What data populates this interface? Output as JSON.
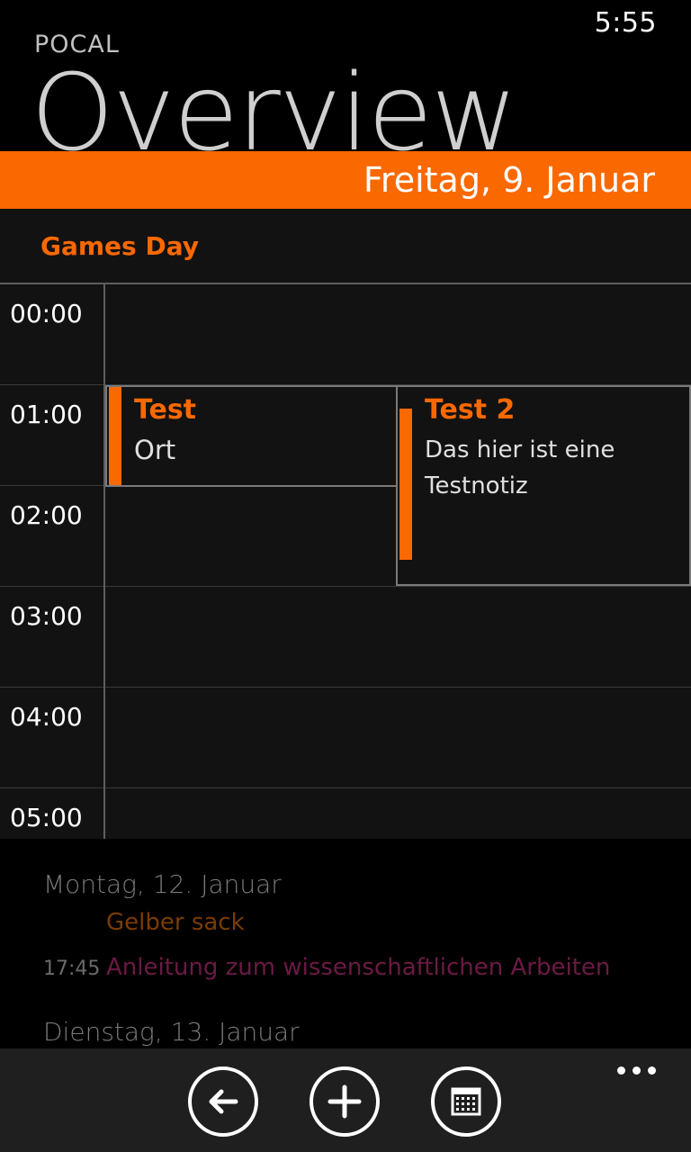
{
  "status_bar": {
    "time": "5:55"
  },
  "header": {
    "app_name": "POCAL",
    "page_title": "Overview"
  },
  "date_header": "Freitag, 9. Januar",
  "all_day_event": "Games Day",
  "hours": [
    "00:00",
    "01:00",
    "02:00",
    "03:00",
    "04:00",
    "05:00"
  ],
  "events": [
    {
      "title": "Test",
      "lines": [
        "Ort"
      ]
    },
    {
      "title": "Test 2",
      "lines": [
        "Das hier ist eine",
        "Testnotiz"
      ]
    }
  ],
  "agenda": {
    "day1": {
      "label": "Montag, 12. Januar",
      "items": [
        {
          "time": "",
          "title": "Gelber sack",
          "color": "#7a3c00"
        },
        {
          "time": "17:45",
          "title": "Anleitung zum wissenschaftlichen Arbeiten",
          "color": "#6b1a45"
        }
      ]
    },
    "day2": {
      "label": "Dienstag, 13. Januar"
    }
  },
  "app_bar": {
    "buttons": [
      {
        "icon": "back-arrow-icon"
      },
      {
        "icon": "add-icon"
      },
      {
        "icon": "calendar-icon"
      }
    ],
    "more_icon": "more-icon"
  },
  "colors": {
    "accent": "#fa6800",
    "panel": "#121212",
    "background": "#000000",
    "app_bar": "#1f1f1f"
  }
}
